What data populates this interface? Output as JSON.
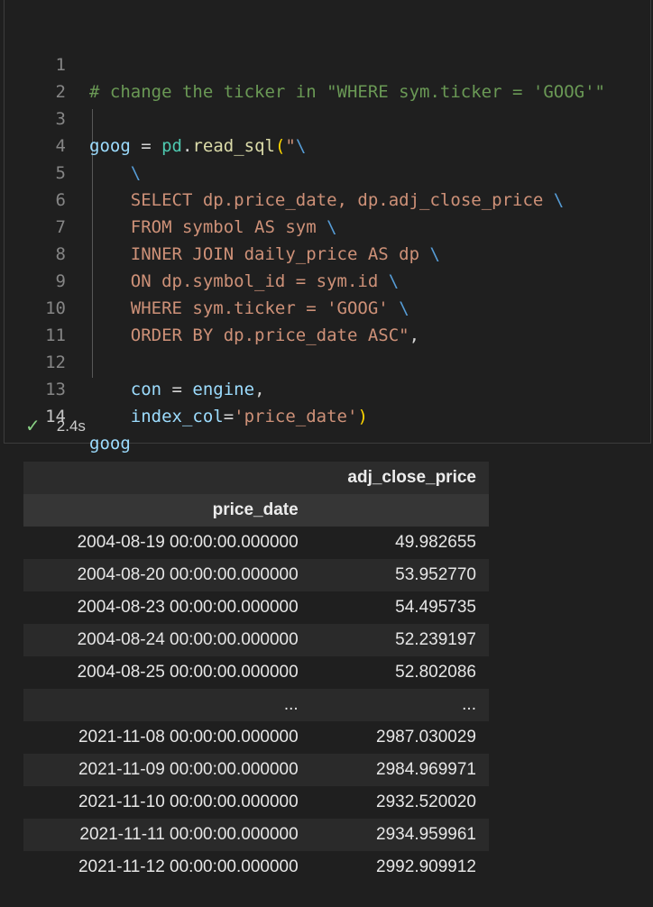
{
  "editor": {
    "line_numbers": [
      "1",
      "2",
      "3",
      "4",
      "5",
      "6",
      "7",
      "8",
      "9",
      "10",
      "11",
      "12",
      "13",
      "14"
    ],
    "lines": {
      "l1_comment": "# change the ticker in \"WHERE sym.ticker = 'GOOG'\"",
      "l3_var": "goog",
      "l3_assign": " = ",
      "l3_module": "pd",
      "l3_dot": ".",
      "l3_fn": "read_sql",
      "l3_paren": "(",
      "l3_str": "\"",
      "l3_esc": "\\",
      "l4_esc": "\\",
      "l5_str": "SELECT dp.price_date, dp.adj_close_price ",
      "l5_esc": "\\",
      "l6_str": "FROM symbol AS sym ",
      "l6_esc": "\\",
      "l7_str": "INNER JOIN daily_price AS dp ",
      "l7_esc": "\\",
      "l8_str": "ON dp.symbol_id = sym.id ",
      "l8_esc": "\\",
      "l9_str": "WHERE sym.ticker = 'GOOG' ",
      "l9_esc": "\\",
      "l10_str": "ORDER BY dp.price_date ASC\"",
      "l10_comma": ",",
      "l12_var": "con",
      "l12_assign": " = ",
      "l12_val": "engine",
      "l12_comma": ",",
      "l13_var": "index_col",
      "l13_eq": "=",
      "l13_str": "'price_date'",
      "l13_paren": ")",
      "l14_var": "goog"
    }
  },
  "status": {
    "check_glyph": "✓",
    "duration": "2.4s"
  },
  "output": {
    "columns": [
      "adj_close_price"
    ],
    "index_name": "price_date",
    "rows": [
      {
        "index": "2004-08-19 00:00:00.000000",
        "value": "49.982655"
      },
      {
        "index": "2004-08-20 00:00:00.000000",
        "value": "53.952770"
      },
      {
        "index": "2004-08-23 00:00:00.000000",
        "value": "54.495735"
      },
      {
        "index": "2004-08-24 00:00:00.000000",
        "value": "52.239197"
      },
      {
        "index": "2004-08-25 00:00:00.000000",
        "value": "52.802086"
      },
      {
        "index": "...",
        "value": "..."
      },
      {
        "index": "2021-11-08 00:00:00.000000",
        "value": "2987.030029"
      },
      {
        "index": "2021-11-09 00:00:00.000000",
        "value": "2984.969971"
      },
      {
        "index": "2021-11-10 00:00:00.000000",
        "value": "2932.520020"
      },
      {
        "index": "2021-11-11 00:00:00.000000",
        "value": "2934.959961"
      },
      {
        "index": "2021-11-12 00:00:00.000000",
        "value": "2992.909912"
      }
    ]
  },
  "colors": {
    "comment": "#6a9955",
    "variable": "#9cdcfe",
    "function": "#dcdcaa",
    "string": "#ce9178",
    "escape": "#569cd6",
    "bracket": "#ffd700",
    "check": "#89d185"
  }
}
